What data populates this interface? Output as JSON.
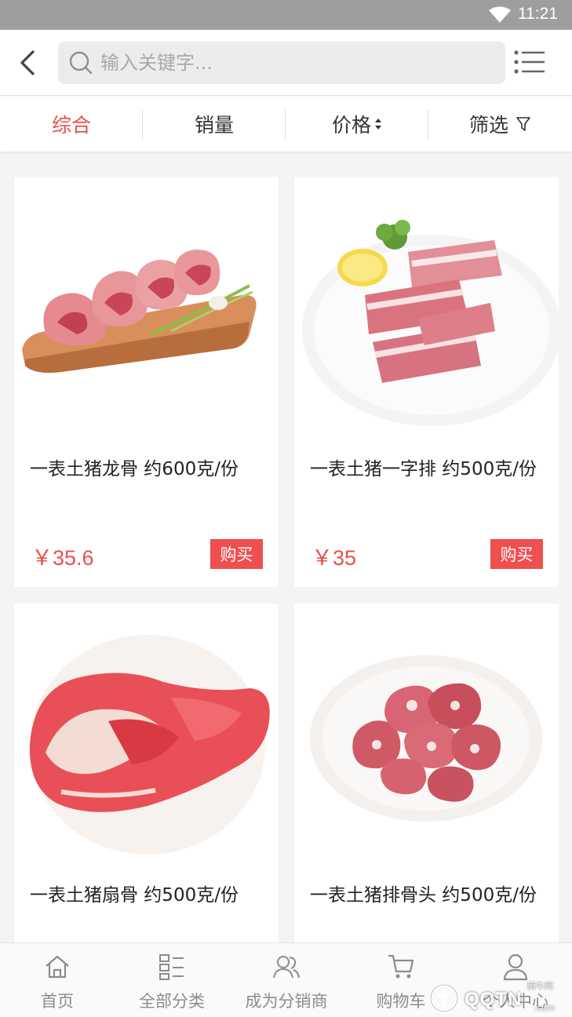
{
  "status_bar": {
    "time": "11:21"
  },
  "search": {
    "placeholder": "输入关键字..."
  },
  "sort_tabs": [
    {
      "label": "综合",
      "active": true
    },
    {
      "label": "销量",
      "active": false
    },
    {
      "label": "价格",
      "active": false
    },
    {
      "label": "筛选",
      "active": false
    }
  ],
  "products": [
    {
      "title": "一表土猪龙骨 约600克/份",
      "price": "￥35.6",
      "buy_label": "购买",
      "image": "pork-spine-on-board"
    },
    {
      "title": "一表土猪一字排 约500克/份",
      "price": "￥35",
      "buy_label": "购买",
      "image": "pork-ribs-on-plate"
    },
    {
      "title": "一表土猪扇骨 约500克/份",
      "price": "",
      "buy_label": "",
      "image": "pork-shoulder-blade"
    },
    {
      "title": "一表土猪排骨头 约500克/份",
      "price": "",
      "buy_label": "",
      "image": "pork-rib-chunks-on-plate"
    }
  ],
  "bottom_nav": [
    {
      "label": "首页",
      "icon": "home-icon"
    },
    {
      "label": "全部分类",
      "icon": "category-icon"
    },
    {
      "label": "成为分销商",
      "icon": "users-icon"
    },
    {
      "label": "购物车",
      "icon": "cart-icon"
    },
    {
      "label": "个人中心",
      "icon": "user-icon"
    }
  ],
  "watermark": {
    "text": "QQTN",
    "small": "腾牛网",
    "domain": ".com"
  },
  "colors": {
    "accent": "#e8504a",
    "buy_button": "#ef4f4f",
    "status_bar": "#9e9e9e"
  }
}
